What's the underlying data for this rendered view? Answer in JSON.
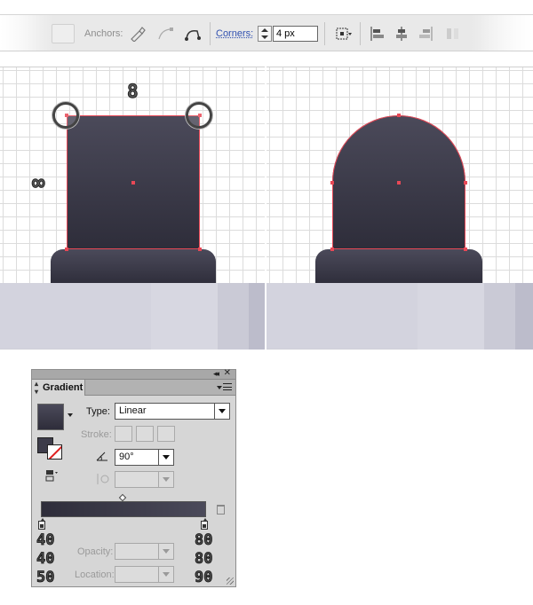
{
  "control_bar": {
    "anchors_label": "Anchors:",
    "corners_label": "Corners:",
    "corners_value": "4 px",
    "icons": [
      "convert-anchor-icon",
      "handles-icon",
      "corner-widget-icon",
      "transform-icon",
      "align-left-icon",
      "align-center-icon",
      "align-right-icon",
      "distribute-icon"
    ]
  },
  "artboard": {
    "top_label": "8",
    "side_label": "∞"
  },
  "colors": {
    "shape_top": "#4b4a5a",
    "shape_bottom": "#2e2d3a",
    "selection": "#e84856",
    "floor": "#d3d3de"
  },
  "gradient_panel": {
    "tab_label": "Gradient",
    "type_label": "Type:",
    "type_value": "Linear",
    "stroke_label": "Stroke:",
    "angle_value": "90°",
    "opacity_label": "Opacity:",
    "location_label": "Location:",
    "left_stop_rgb": [
      "40",
      "40",
      "50"
    ],
    "right_stop_rgb": [
      "80",
      "80",
      "90"
    ]
  }
}
